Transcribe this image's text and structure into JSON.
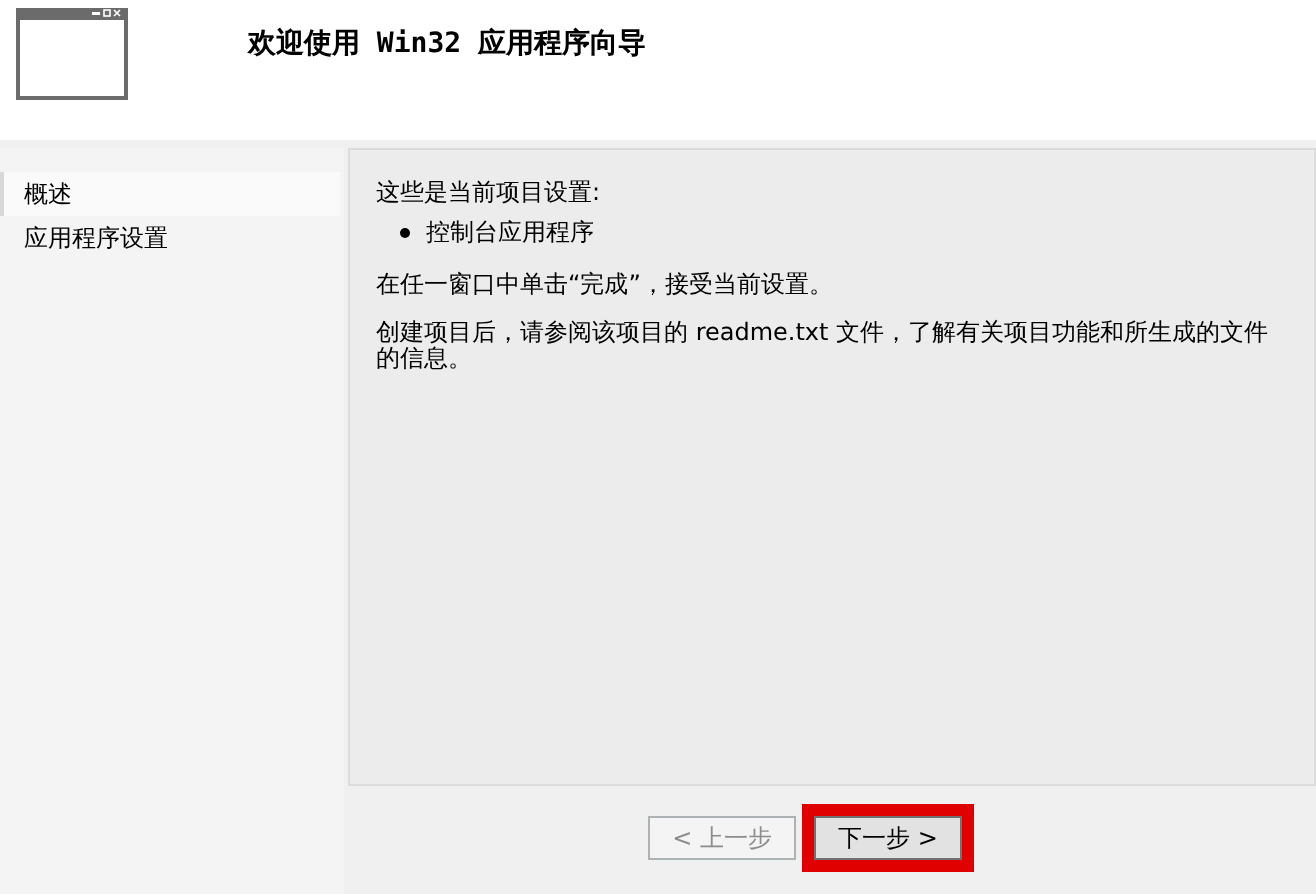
{
  "header": {
    "title": "欢迎使用 Win32 应用程序向导"
  },
  "sidebar": {
    "items": [
      {
        "label": "概述",
        "selected": true
      },
      {
        "label": "应用程序设置",
        "selected": false
      }
    ]
  },
  "content": {
    "intro": "这些是当前项目设置:",
    "bullets": [
      "控制台应用程序"
    ],
    "paragraphs": [
      "在任一窗口中单击“完成”，接受当前设置。",
      "创建项目后，请参阅该项目的 readme.txt 文件，了解有关项目功能和所生成的文件的信息。"
    ]
  },
  "buttons": [
    {
      "label": "< 上一步",
      "disabled": true,
      "highlighted": false
    },
    {
      "label": "下一步 >",
      "disabled": false,
      "highlighted": true
    }
  ]
}
